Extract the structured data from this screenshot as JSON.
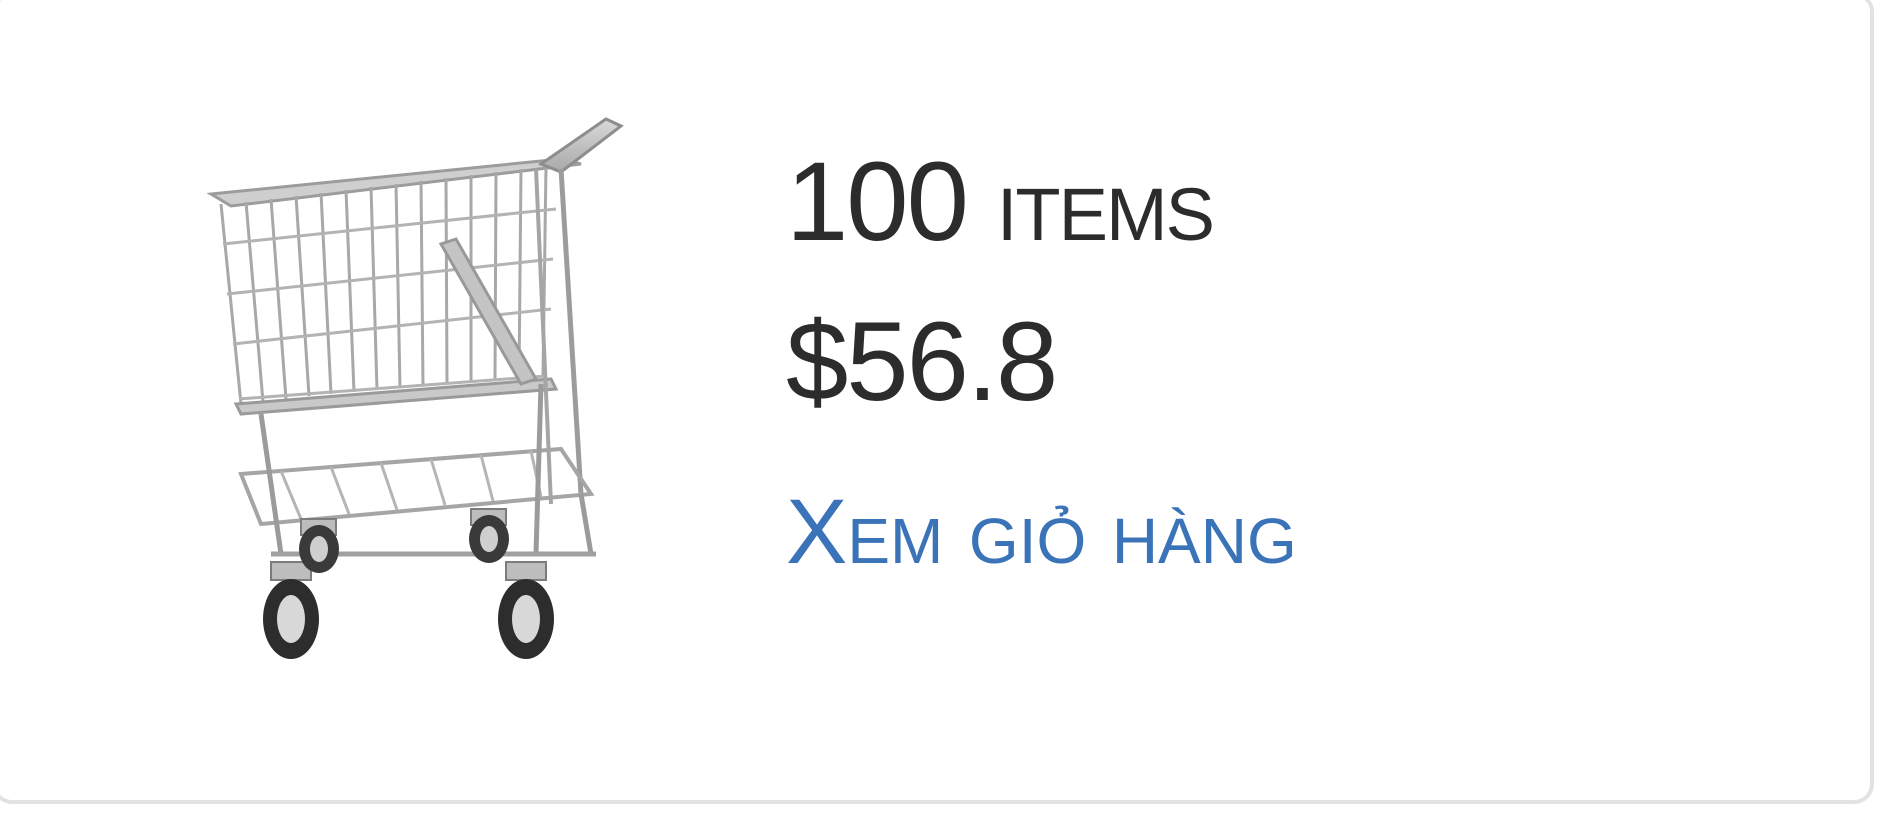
{
  "cart": {
    "item_count": "100",
    "item_label": "items",
    "total": "$56.8",
    "view_cart_label": "Xem giỏ hàng"
  },
  "icons": {
    "cart": "shopping-cart-icon"
  },
  "colors": {
    "link": "#3a73b7",
    "text": "#2c2c2c",
    "border": "#e2e2e2"
  }
}
